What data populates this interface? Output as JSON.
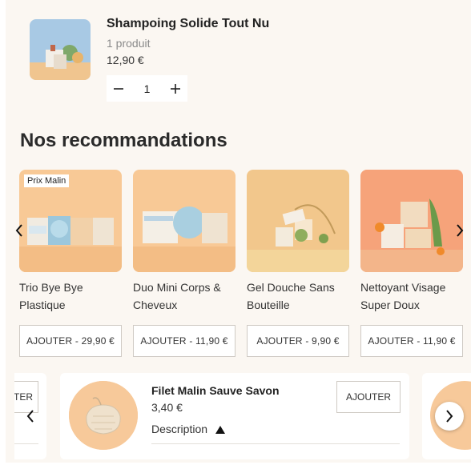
{
  "cart": {
    "title": "Shampoing Solide Tout Nu",
    "quantity_text": "1 produit",
    "price": "12,90 €",
    "quantity_value": "1"
  },
  "recommendations": {
    "heading": "Nos recommandations",
    "products": [
      {
        "badge": "Prix Malin",
        "name": "Trio Bye Bye Plastique",
        "button": "AJOUTER - 29,90 €"
      },
      {
        "name": "Duo Mini Corps & Cheveux",
        "button": "AJOUTER - 11,90 €"
      },
      {
        "name": "Gel Douche Sans Bouteille",
        "button": "AJOUTER - 9,90 €"
      },
      {
        "name": "Nettoyant Visage Super Doux",
        "button": "AJOUTER - 11,90 €"
      }
    ]
  },
  "upsell": {
    "prev_partial_button": "TER",
    "title": "Filet Malin Sauve Savon",
    "price": "3,40 €",
    "description_label": "Description",
    "button": "AJOUTER"
  },
  "icons": {
    "minus": "minus-icon",
    "plus": "plus-icon",
    "prev": "chevron-left-icon",
    "next": "chevron-right-icon",
    "triangle": "triangle-up-icon"
  },
  "colors": {
    "panel_bg": "#fbf7f2",
    "peach": "#f7c99a",
    "border": "#cfcac4"
  }
}
